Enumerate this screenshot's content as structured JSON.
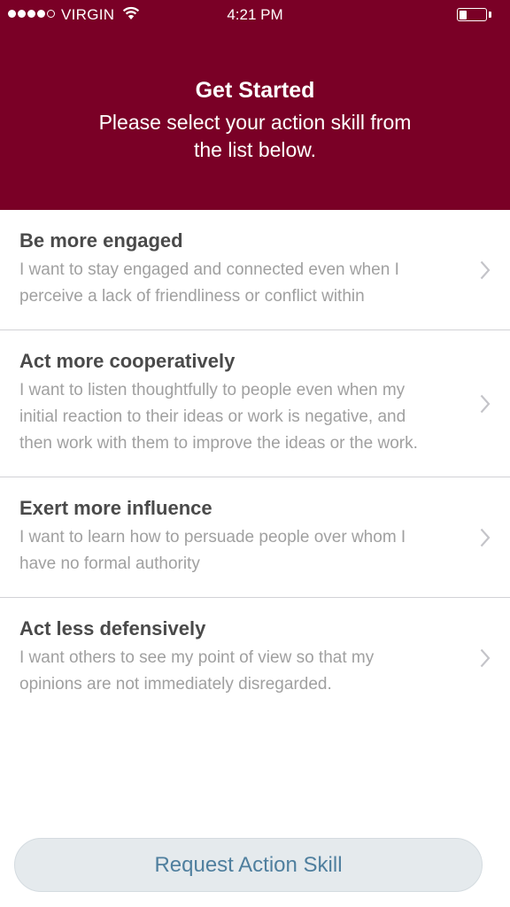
{
  "status_bar": {
    "carrier": "VIRGIN",
    "time": "4:21 PM",
    "signal_bars_filled": 4,
    "signal_bars_total": 5,
    "battery_level": 0.28
  },
  "header": {
    "title": "Get Started",
    "subtitle": "Please select your action skill from the list below.",
    "background_color": "#7a0026"
  },
  "skills": [
    {
      "title": "Be more engaged",
      "description": "I want to stay engaged and connected even when I perceive a lack of friendliness or conflict within"
    },
    {
      "title": "Act more cooperatively",
      "description": "I want to listen thoughtfully to people even when my initial reaction to their ideas or work is negative, and then work with them to improve the ideas or the work."
    },
    {
      "title": "Exert more influence",
      "description": "I want to learn how to persuade people over whom I have no formal authority"
    },
    {
      "title": "Act less defensively",
      "description": "I want others to see my point of view so that my opinions are not immediately disregarded."
    }
  ],
  "cta": {
    "label": "Request Action Skill"
  },
  "icons": {
    "row_chevron": "chevron-right-icon",
    "wifi": "wifi-icon",
    "battery": "battery-icon"
  }
}
